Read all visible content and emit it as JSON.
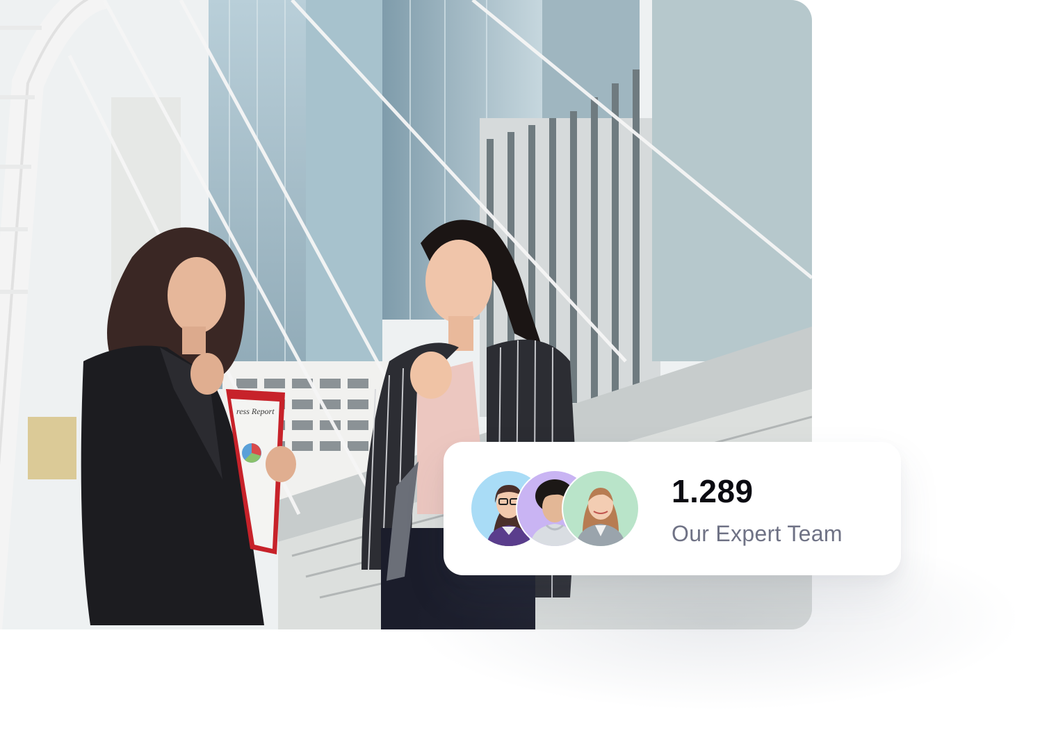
{
  "hero": {
    "image": "two-businesswomen-celebrating-photo",
    "clipboard_text": "ress Report"
  },
  "stat_card": {
    "value": "1.289",
    "label": "Our Expert Team",
    "avatars": [
      {
        "name": "team-member-avatar-1",
        "bg": "#a9dcf6"
      },
      {
        "name": "team-member-avatar-2",
        "bg": "#c9b4f3"
      },
      {
        "name": "team-member-avatar-3",
        "bg": "#b9e4c9"
      }
    ]
  }
}
